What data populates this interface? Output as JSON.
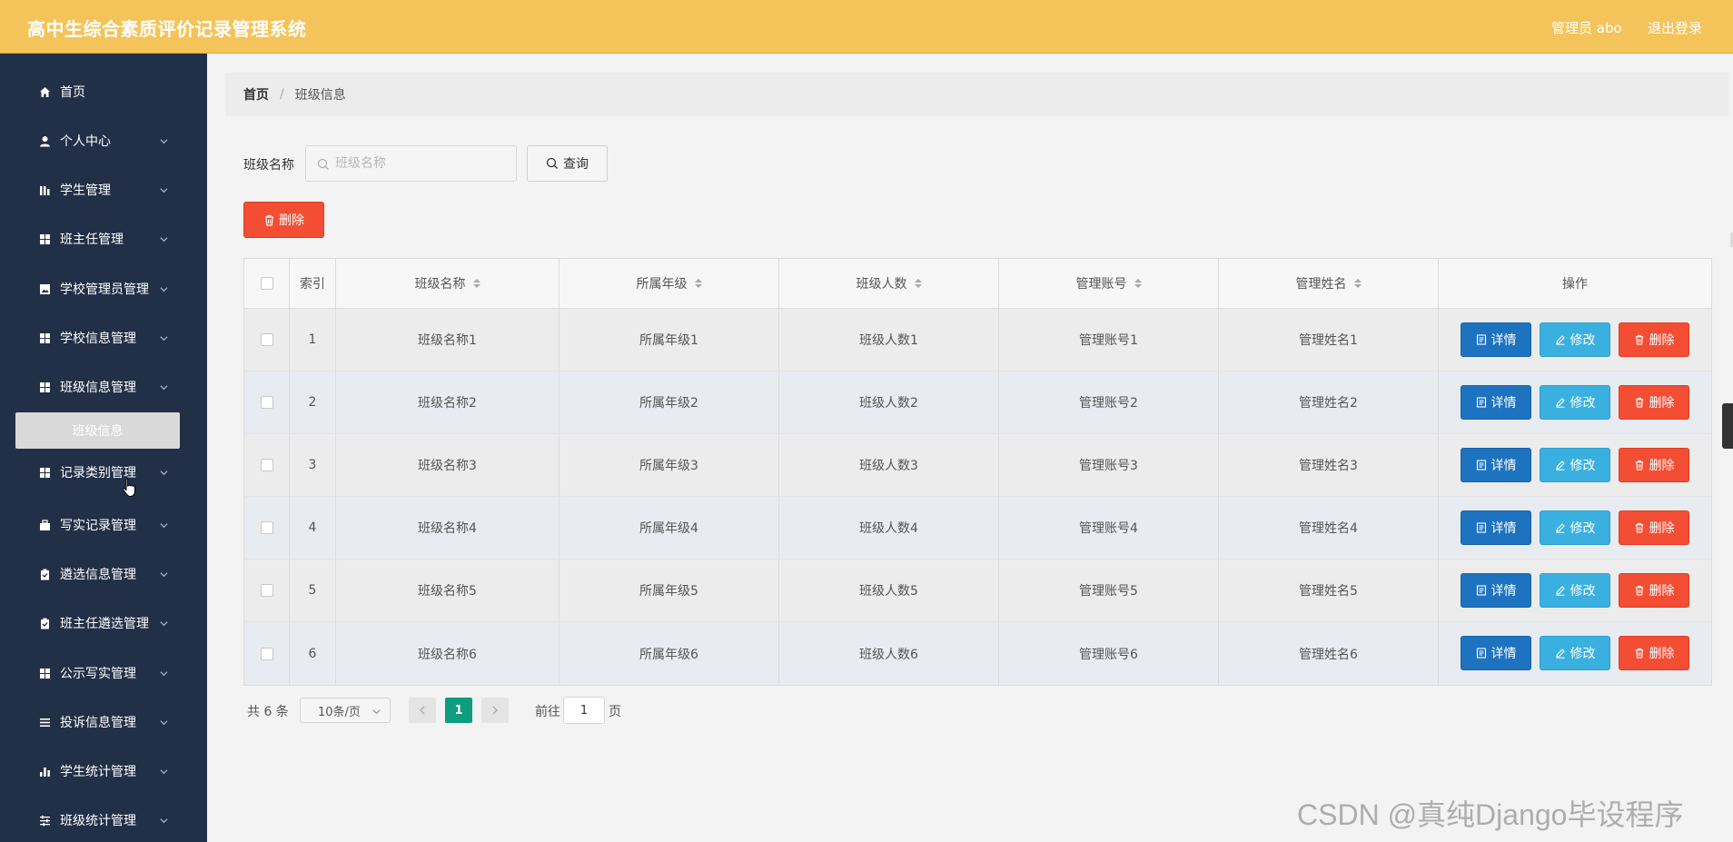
{
  "header": {
    "title": "高中生综合素质评价记录管理系统",
    "admin_label": "管理员 abo",
    "logout_label": "退出登录"
  },
  "sidebar": {
    "items": [
      {
        "label": "首页",
        "icon": "home-icon"
      },
      {
        "label": "个人中心",
        "icon": "user-icon"
      },
      {
        "label": "学生管理",
        "icon": "bar-chart-icon"
      },
      {
        "label": "班主任管理",
        "icon": "grid-icon"
      },
      {
        "label": "学校管理员管理",
        "icon": "picture-icon"
      },
      {
        "label": "学校信息管理",
        "icon": "grid-icon"
      },
      {
        "label": "班级信息管理",
        "icon": "grid-icon"
      },
      {
        "label": "记录类别管理",
        "icon": "grid-icon"
      },
      {
        "label": "写实记录管理",
        "icon": "briefcase-icon"
      },
      {
        "label": "遴选信息管理",
        "icon": "clipboard-icon"
      },
      {
        "label": "班主任遴选管理",
        "icon": "clipboard-icon"
      },
      {
        "label": "公示写实管理",
        "icon": "grid-icon"
      },
      {
        "label": "投诉信息管理",
        "icon": "menu-icon"
      },
      {
        "label": "学生统计管理",
        "icon": "stats-icon"
      },
      {
        "label": "班级统计管理",
        "icon": "sliders-icon"
      }
    ],
    "active_sub": "班级信息"
  },
  "breadcrumb": {
    "home": "首页",
    "separator": "/",
    "current": "班级信息"
  },
  "search": {
    "label": "班级名称",
    "placeholder": "班级名称",
    "value": "",
    "button_label": "查询"
  },
  "toolbar": {
    "delete_label": "删除"
  },
  "table": {
    "headers": [
      "索引",
      "班级名称",
      "所属年级",
      "班级人数",
      "管理账号",
      "管理姓名",
      "操作"
    ],
    "rows": [
      {
        "index": "1",
        "name": "班级名称1",
        "grade": "所属年级1",
        "count": "班级人数1",
        "account": "管理账号1",
        "manager": "管理姓名1"
      },
      {
        "index": "2",
        "name": "班级名称2",
        "grade": "所属年级2",
        "count": "班级人数2",
        "account": "管理账号2",
        "manager": "管理姓名2"
      },
      {
        "index": "3",
        "name": "班级名称3",
        "grade": "所属年级3",
        "count": "班级人数3",
        "account": "管理账号3",
        "manager": "管理姓名3"
      },
      {
        "index": "4",
        "name": "班级名称4",
        "grade": "所属年级4",
        "count": "班级人数4",
        "account": "管理账号4",
        "manager": "管理姓名4"
      },
      {
        "index": "5",
        "name": "班级名称5",
        "grade": "所属年级5",
        "count": "班级人数5",
        "account": "管理账号5",
        "manager": "管理姓名5"
      },
      {
        "index": "6",
        "name": "班级名称6",
        "grade": "所属年级6",
        "count": "班级人数6",
        "account": "管理账号6",
        "manager": "管理姓名6"
      }
    ],
    "actions": {
      "detail": "详情",
      "edit": "修改",
      "delete": "删除"
    }
  },
  "pagination": {
    "total": "共 6 条",
    "page_size": "10条/页",
    "current_page": "1",
    "goto_label": "前往",
    "goto_value": "1",
    "page_suffix": "页"
  },
  "watermark": "CSDN @真纯Django毕设程序",
  "colors": {
    "header_bg": "#f4c45a",
    "sidebar_bg": "#223047",
    "detail_btn": "#1e73c0",
    "edit_btn": "#3ab0e0",
    "delete_btn": "#f34e34",
    "active_page": "#0e9d7f"
  }
}
